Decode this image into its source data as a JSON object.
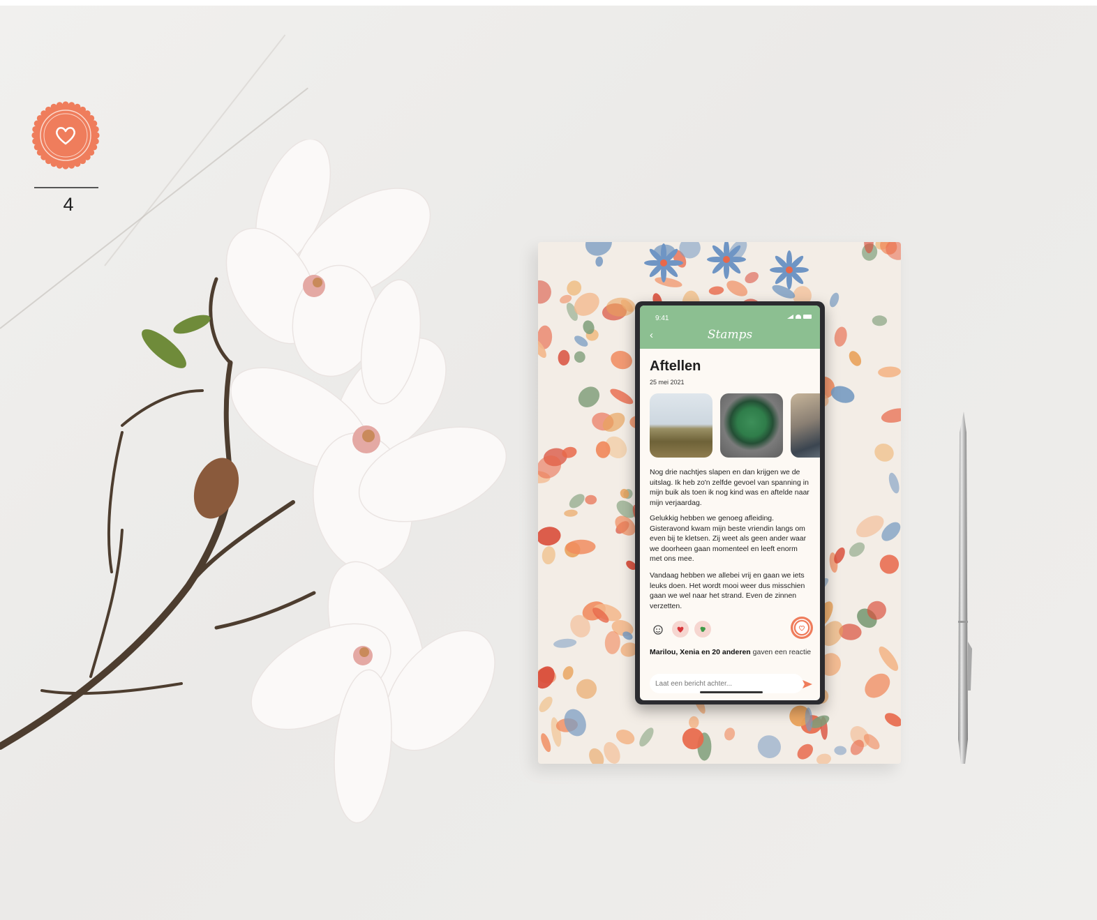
{
  "page": {
    "number": "4",
    "badge_icon": "heart-icon",
    "accent_color": "#ef7d5c"
  },
  "app": {
    "status_time": "9:41",
    "title": "Stamps",
    "header_color": "#8cbf91",
    "back_icon": "chevron-left-icon"
  },
  "post": {
    "title": "Aftellen",
    "date": "25 mei 2021",
    "paragraphs": [
      "Nog drie nachtjes slapen en dan krijgen we de uitslag. Ik heb zo'n zelfde gevoel van spanning in mijn buik als toen ik nog kind was en aftelde naar mijn verjaardag.",
      "Gelukkig hebben we genoeg afleiding. Gisteravond kwam mijn beste vriendin langs om even bij te kletsen. Zij weet als geen ander waar we doorheen gaan momenteel en leeft enorm met ons mee.",
      "Vandaag hebben we allebei vrij en gaan we iets leuks doen. Het wordt mooi weer dus misschien gaan we wel naar het strand. Even de zinnen verzetten."
    ],
    "reactions": [
      "smiley-add-icon",
      "heart-icon",
      "clover-icon"
    ],
    "like_names": "Marilou, Xenia en 20 anderen",
    "like_suffix": " gaven een reactie",
    "comment_placeholder": "Laat een bericht achter..."
  }
}
